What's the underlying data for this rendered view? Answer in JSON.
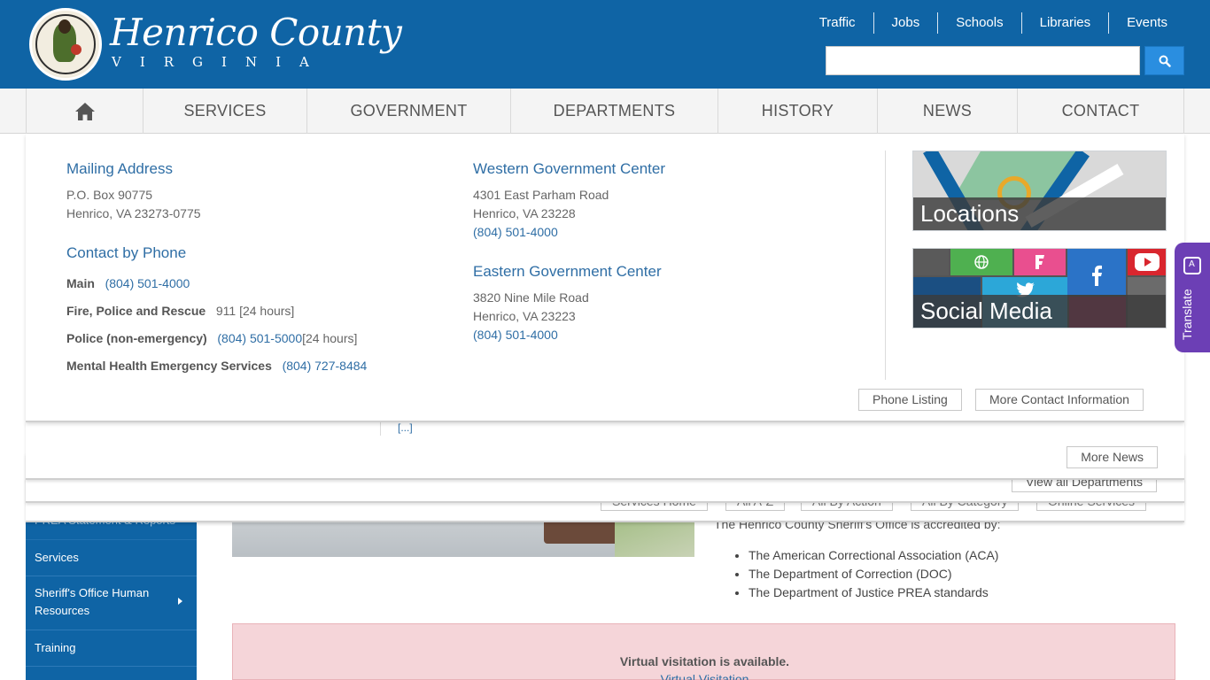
{
  "header": {
    "brand_title": "Henrico County",
    "brand_subtitle": "VIRGINIA",
    "top_links": [
      "Traffic",
      "Jobs",
      "Schools",
      "Libraries",
      "Events"
    ],
    "search": {
      "placeholder": "",
      "button_icon": "search-icon"
    }
  },
  "nav": {
    "home_icon": "home-icon",
    "items": [
      "SERVICES",
      "GOVERNMENT",
      "DEPARTMENTS",
      "HISTORY",
      "NEWS",
      "CONTACT"
    ]
  },
  "contact_panel": {
    "mailing": {
      "title": "Mailing Address",
      "line1": "P.O. Box 90775",
      "line2": "Henrico, VA 23273-0775"
    },
    "phone": {
      "title": "Contact by Phone",
      "rows": [
        {
          "label": "Main",
          "number": "(804) 501-4000",
          "note": ""
        },
        {
          "label": "Fire, Police and Rescue",
          "number": "911",
          "note": "[24 hours]"
        },
        {
          "label": "Police (non-emergency)",
          "number": "(804) 501-5000",
          "note": "[24 hours]"
        },
        {
          "label": "Mental Health Emergency Services",
          "number": "(804) 727-8484",
          "note": ""
        }
      ]
    },
    "western": {
      "title": "Western Government Center",
      "line1": "4301 East Parham Road",
      "line2": "Henrico, VA 23228",
      "phone": "(804) 501-4000"
    },
    "eastern": {
      "title": "Eastern Government Center",
      "line1": "3820 Nine Mile Road",
      "line2": "Henrico, VA 23223",
      "phone": "(804) 501-4000"
    },
    "tiles": {
      "locations": "Locations",
      "social": "Social Media"
    },
    "buttons": {
      "phone_listing": "Phone Listing",
      "more_contact": "More Contact Information"
    }
  },
  "news_panel": {
    "ellipsis_link": "[...]",
    "more_news": "More News"
  },
  "departments_panel": {
    "view_all": "View all Departments"
  },
  "services_panel": {
    "buttons": [
      "Services Home",
      "All A-Z",
      "All By Action",
      "All By Category",
      "Online Services"
    ]
  },
  "sidebar": {
    "items": [
      "PREA Statement & Reports",
      "Services",
      "Sheriff's Office Human Resources",
      "Training"
    ]
  },
  "content": {
    "accreditation_intro": "The Henrico County Sheriff's Office is accredited by:",
    "accreditations": [
      "The American Correctional Association (ACA)",
      "The Department of Correction (DOC)",
      "The Department of Justice PREA standards"
    ],
    "alert_title": "Virtual visitation is available.",
    "alert_link": "Virtual Visitation"
  },
  "translate": {
    "label": "Translate"
  },
  "colors": {
    "header_blue": "#0f64a5",
    "link_blue": "#2f6ea5",
    "search_button": "#2a8ee0",
    "translate_purple": "#6c3fb5",
    "alert_pink": "#f5d5d9"
  }
}
